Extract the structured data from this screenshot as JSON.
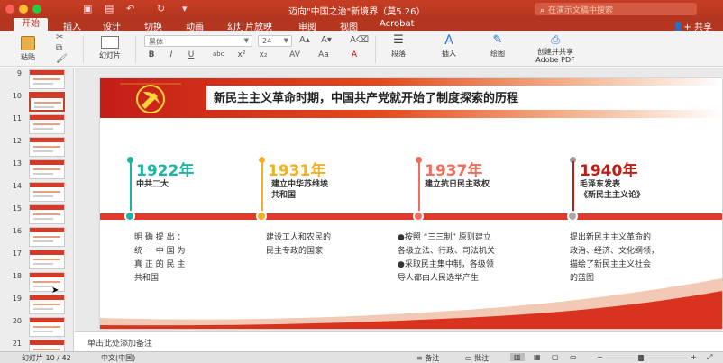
{
  "window": {
    "title": "迈向\"中国之治\"新境界（莫5.26）",
    "search_placeholder": "在演示文稿中搜索",
    "share_label": "共享"
  },
  "ribbon_tabs": [
    "开始",
    "插入",
    "设计",
    "切换",
    "动画",
    "幻灯片放映",
    "审阅",
    "视图",
    "Acrobat"
  ],
  "active_tab": "开始",
  "ribbon": {
    "paste": "粘贴",
    "slides": "幻灯片",
    "font_name": "黑体",
    "font_size": "24",
    "paragraph": "段落",
    "insert": "插入",
    "drawing": "绘图",
    "create_pdf_1": "创建并共享",
    "create_pdf_2": "Adobe PDF"
  },
  "thumbnails": [
    "9",
    "10",
    "11",
    "12",
    "13",
    "14",
    "15",
    "16",
    "17",
    "18",
    "19",
    "20",
    "21"
  ],
  "selected_slide": "10",
  "slide": {
    "title": "新民主主义革命时期，中国共产党就开始了制度探索的历程",
    "events": [
      {
        "year": "1922年",
        "sub": [
          "中共二大"
        ],
        "desc": [
          "明 确 提 出 ：",
          "统 一 中 国 为",
          "真 正 的 民 主",
          "共和国"
        ],
        "color": "#1fb3a2"
      },
      {
        "year": "1931年",
        "sub": [
          "建立中华苏维埃",
          "共和国"
        ],
        "desc": [
          "建设工人和农民的",
          "民主专政的国家"
        ],
        "color": "#f2b023"
      },
      {
        "year": "1937年",
        "sub": [
          "建立抗日民主政权"
        ],
        "desc": [
          "●按照 “三三制” 原则建立",
          "各级立法、行政、司法机关",
          "●采取民主集中制，各级领",
          "导人都由人民选举产生"
        ],
        "color": "#f06e5c"
      },
      {
        "year": "1940年",
        "sub": [
          "毛泽东发表",
          "《新民主主义论》"
        ],
        "desc": [
          "提出新民主主义革命的",
          "政治、经济、文化纲领，",
          "描绘了新民主主义社会",
          "的蓝图"
        ],
        "color": "#c01c16"
      }
    ]
  },
  "notes_placeholder": "单击此处添加备注",
  "status": {
    "slide_count": "幻灯片 10 / 42",
    "language": "中文(中国)",
    "notes_button": "备注",
    "comments_button": "批注"
  },
  "colors": {
    "brand": "#b5361f",
    "timeline": "#e03b2a"
  }
}
